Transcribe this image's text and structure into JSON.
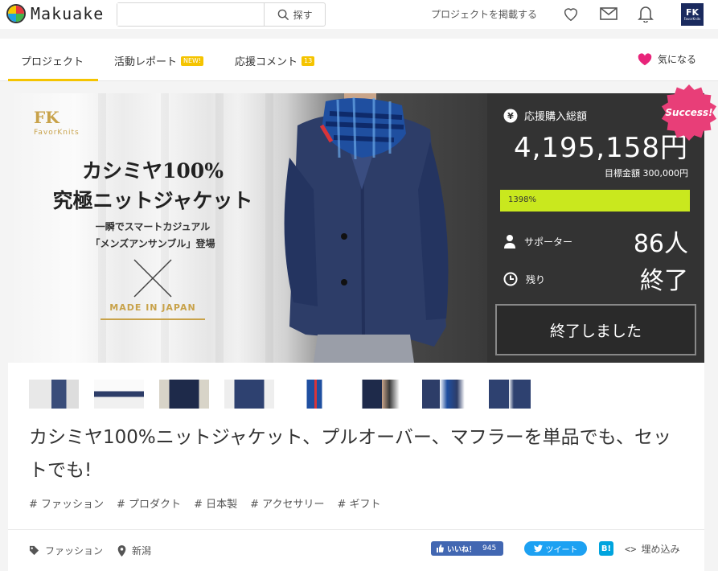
{
  "header": {
    "logo_text": "Makuake",
    "search": {
      "placeholder": "",
      "button_label": "探す"
    },
    "post_project": "プロジェクトを掲載する",
    "avatar_text": "FK",
    "avatar_sub": "FavorKnits"
  },
  "tabs": [
    {
      "label": "プロジェクト",
      "active": true
    },
    {
      "label": "活動レポート",
      "badge": "NEW!"
    },
    {
      "label": "応援コメント",
      "badge": "13"
    }
  ],
  "favorite_label": "気になる",
  "hero": {
    "brand_mark": "FK",
    "brand_name": "FavorKnits",
    "title_line1": "カシミヤ100%",
    "title_line2": "究極ニットジャケット",
    "sub_line1": "一瞬でスマートカジュアル",
    "sub_line2": "「メンズアンサンブル」登場",
    "made_in": "MADE IN JAPAN"
  },
  "panel": {
    "total_label": "応援購入総額",
    "total_amount": "4,195,158円",
    "goal": "目標金額 300,000円",
    "progress_text": "1398%",
    "progress_fraction": 1.0,
    "supporters_label": "サポーター",
    "supporters_value": "86人",
    "remaining_label": "残り",
    "remaining_value": "終了",
    "success_badge": "Success!",
    "ended_button": "終了しました",
    "accent_color": "#c9e81e",
    "badge_color": "#e83e78"
  },
  "thumbnails_count": 8,
  "title": "カシミヤ100%ニットジャケット、プルオーバー、マフラーを単品でも、セットでも!",
  "tags": [
    "# ファッション",
    "# プロダクト",
    "# 日本製",
    "# アクセサリー",
    "# ギフト"
  ],
  "meta": {
    "category": "ファッション",
    "location": "新潟"
  },
  "share": {
    "facebook_label": "いいね！",
    "facebook_count": "945",
    "tweet_label": "ツイート",
    "hatena_label": "B!",
    "embed_label": "埋め込み"
  }
}
